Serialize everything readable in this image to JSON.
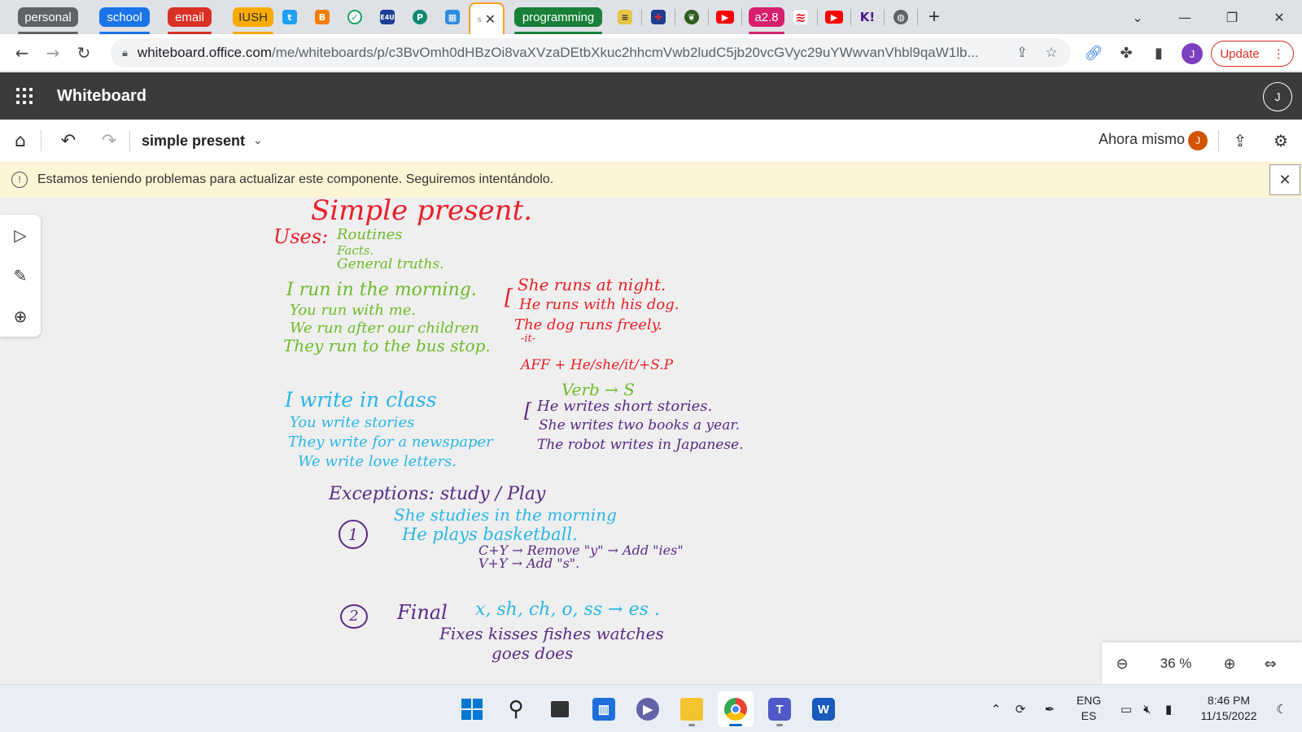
{
  "browser": {
    "tab_groups": [
      {
        "label": "personal",
        "color": "#5f6368"
      },
      {
        "label": "school",
        "color": "#1a73e8"
      },
      {
        "label": "email",
        "color": "#d93025"
      },
      {
        "label": "IUSH",
        "color": "#f9ab00"
      },
      {
        "label": "programming",
        "color": "#188038"
      }
    ],
    "active_tab": {
      "title": "s",
      "close_glyph": "✕"
    },
    "misc_tab_labels": {
      "e4u": "E4U",
      "p": "P",
      "a28": "a2.8",
      "k": "K!",
      "b": "B"
    },
    "new_tab_glyph": "+",
    "url_host": "whiteboard.office.com",
    "url_path": "/me/whiteboards/p/c3BvOmh0dHBzOi8vaXVzaDEtbXkuc2hhcmVwb2ludC5jb20vcGVyc29uYWwvanVhbl9qaW1lb...",
    "profile_initial": "J",
    "update_label": "Update",
    "update_menu_glyph": "⋮"
  },
  "app": {
    "title": "Whiteboard",
    "avatar_initial": "J"
  },
  "toolbar": {
    "board_name": "simple present",
    "saved_status": "Ahora mismo",
    "owner_initial": "J"
  },
  "banner": {
    "message": "Estamos teniendo problemas para actualizar este componente. Seguiremos intentándolo.",
    "icon_glyph": "!",
    "close_glyph": "✕"
  },
  "canvas": {
    "ink": {
      "title": "Simple present.",
      "uses_label": "Uses:",
      "uses_1": "Routines",
      "uses_2": "Facts.",
      "uses_3": "General truths.",
      "green_1": "I run in the morning.",
      "green_2": "You run with me.",
      "green_3": "We run after our children",
      "green_4": "They run to the bus stop.",
      "red_1": "She runs at night.",
      "red_2": "He runs with his dog.",
      "red_3": "The dog runs freely.",
      "red_4": "-it-",
      "rule_1": "AFF + He/she/it/+S.P",
      "rule_2": "Verb → S",
      "blue_1": "I write in class",
      "blue_2": "You write stories",
      "blue_3": "They write for a newspaper",
      "blue_4": "We write love letters.",
      "purple_1": "He writes short stories.",
      "purple_2": "She writes two books a year.",
      "purple_3": "The robot writes in Japanese.",
      "exceptions": "Exceptions: study / Play",
      "num_1": "1",
      "exc_1": "She studies in the morning",
      "exc_2": "He plays basketball.",
      "exc_3": "C+Y → Remove \"y\" → Add \"ies\"",
      "exc_4": "V+Y → Add \"s\".",
      "num_2": "2",
      "final_label": "Final",
      "final_rule": "x, sh, ch, o, ss → es .",
      "final_ex_1": "Fixes  kisses  fishes  watches",
      "final_ex_2": "goes     does"
    },
    "zoom": "36 %"
  },
  "taskbar": {
    "lang_top": "ENG",
    "lang_bottom": "ES",
    "time": "8:46 PM",
    "date": "11/15/2022"
  }
}
